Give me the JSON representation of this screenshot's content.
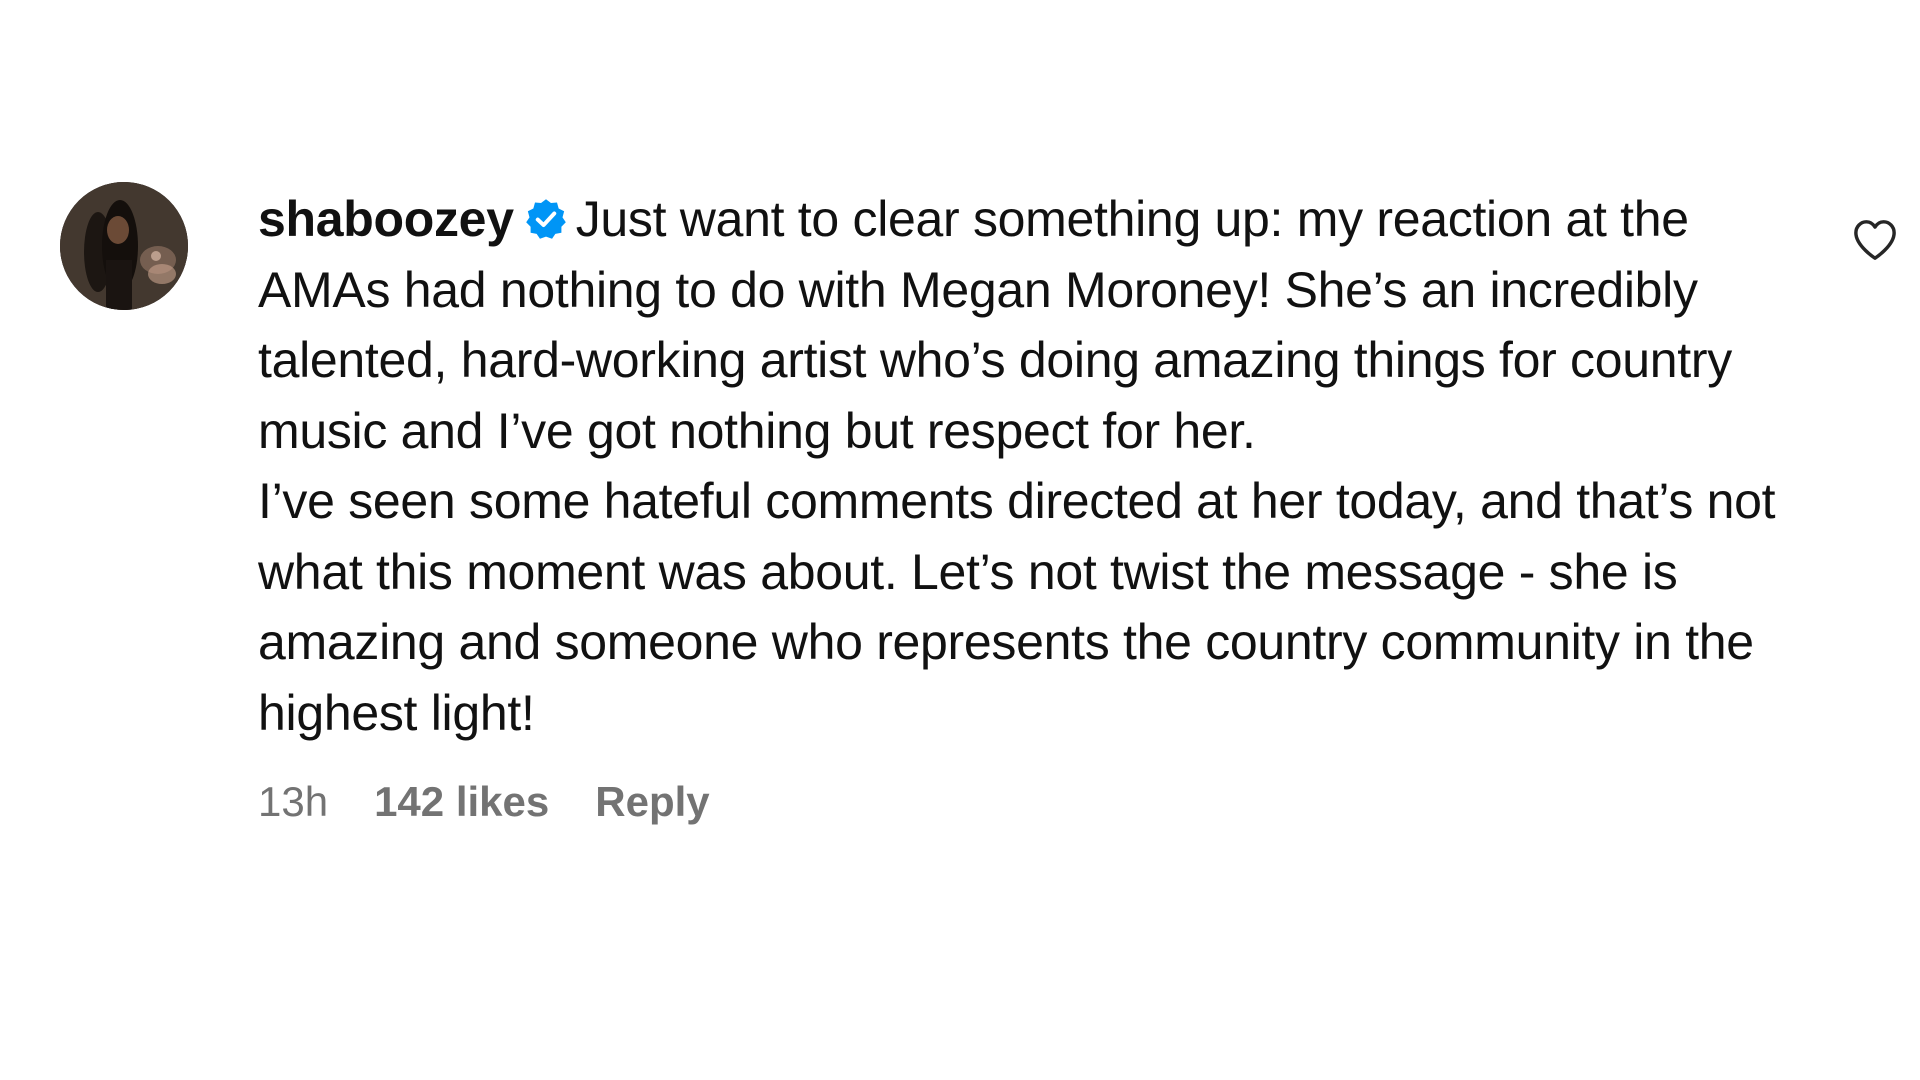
{
  "comment": {
    "username": "shaboozey",
    "verified": true,
    "paragraph1": "Just want to clear something up: my reaction at the AMAs had nothing to do with Megan Moroney! She’s an incredibly talented, hard-working artist who’s doing amazing things for country music and I’ve got nothing but respect for her.",
    "paragraph2": "I’ve seen some hateful comments directed at her today, and that’s not what this moment was about. Let’s not twist the message - she is amazing and someone who represents the country community in the highest light!",
    "time": "13h",
    "likes": "142 likes",
    "reply_label": "Reply"
  },
  "icons": {
    "avatar": "profile-avatar",
    "verified": "verified-badge-icon",
    "like": "heart-outline-icon"
  },
  "colors": {
    "verified_blue": "#0095f6",
    "meta_gray": "#737373",
    "text": "#111111"
  }
}
